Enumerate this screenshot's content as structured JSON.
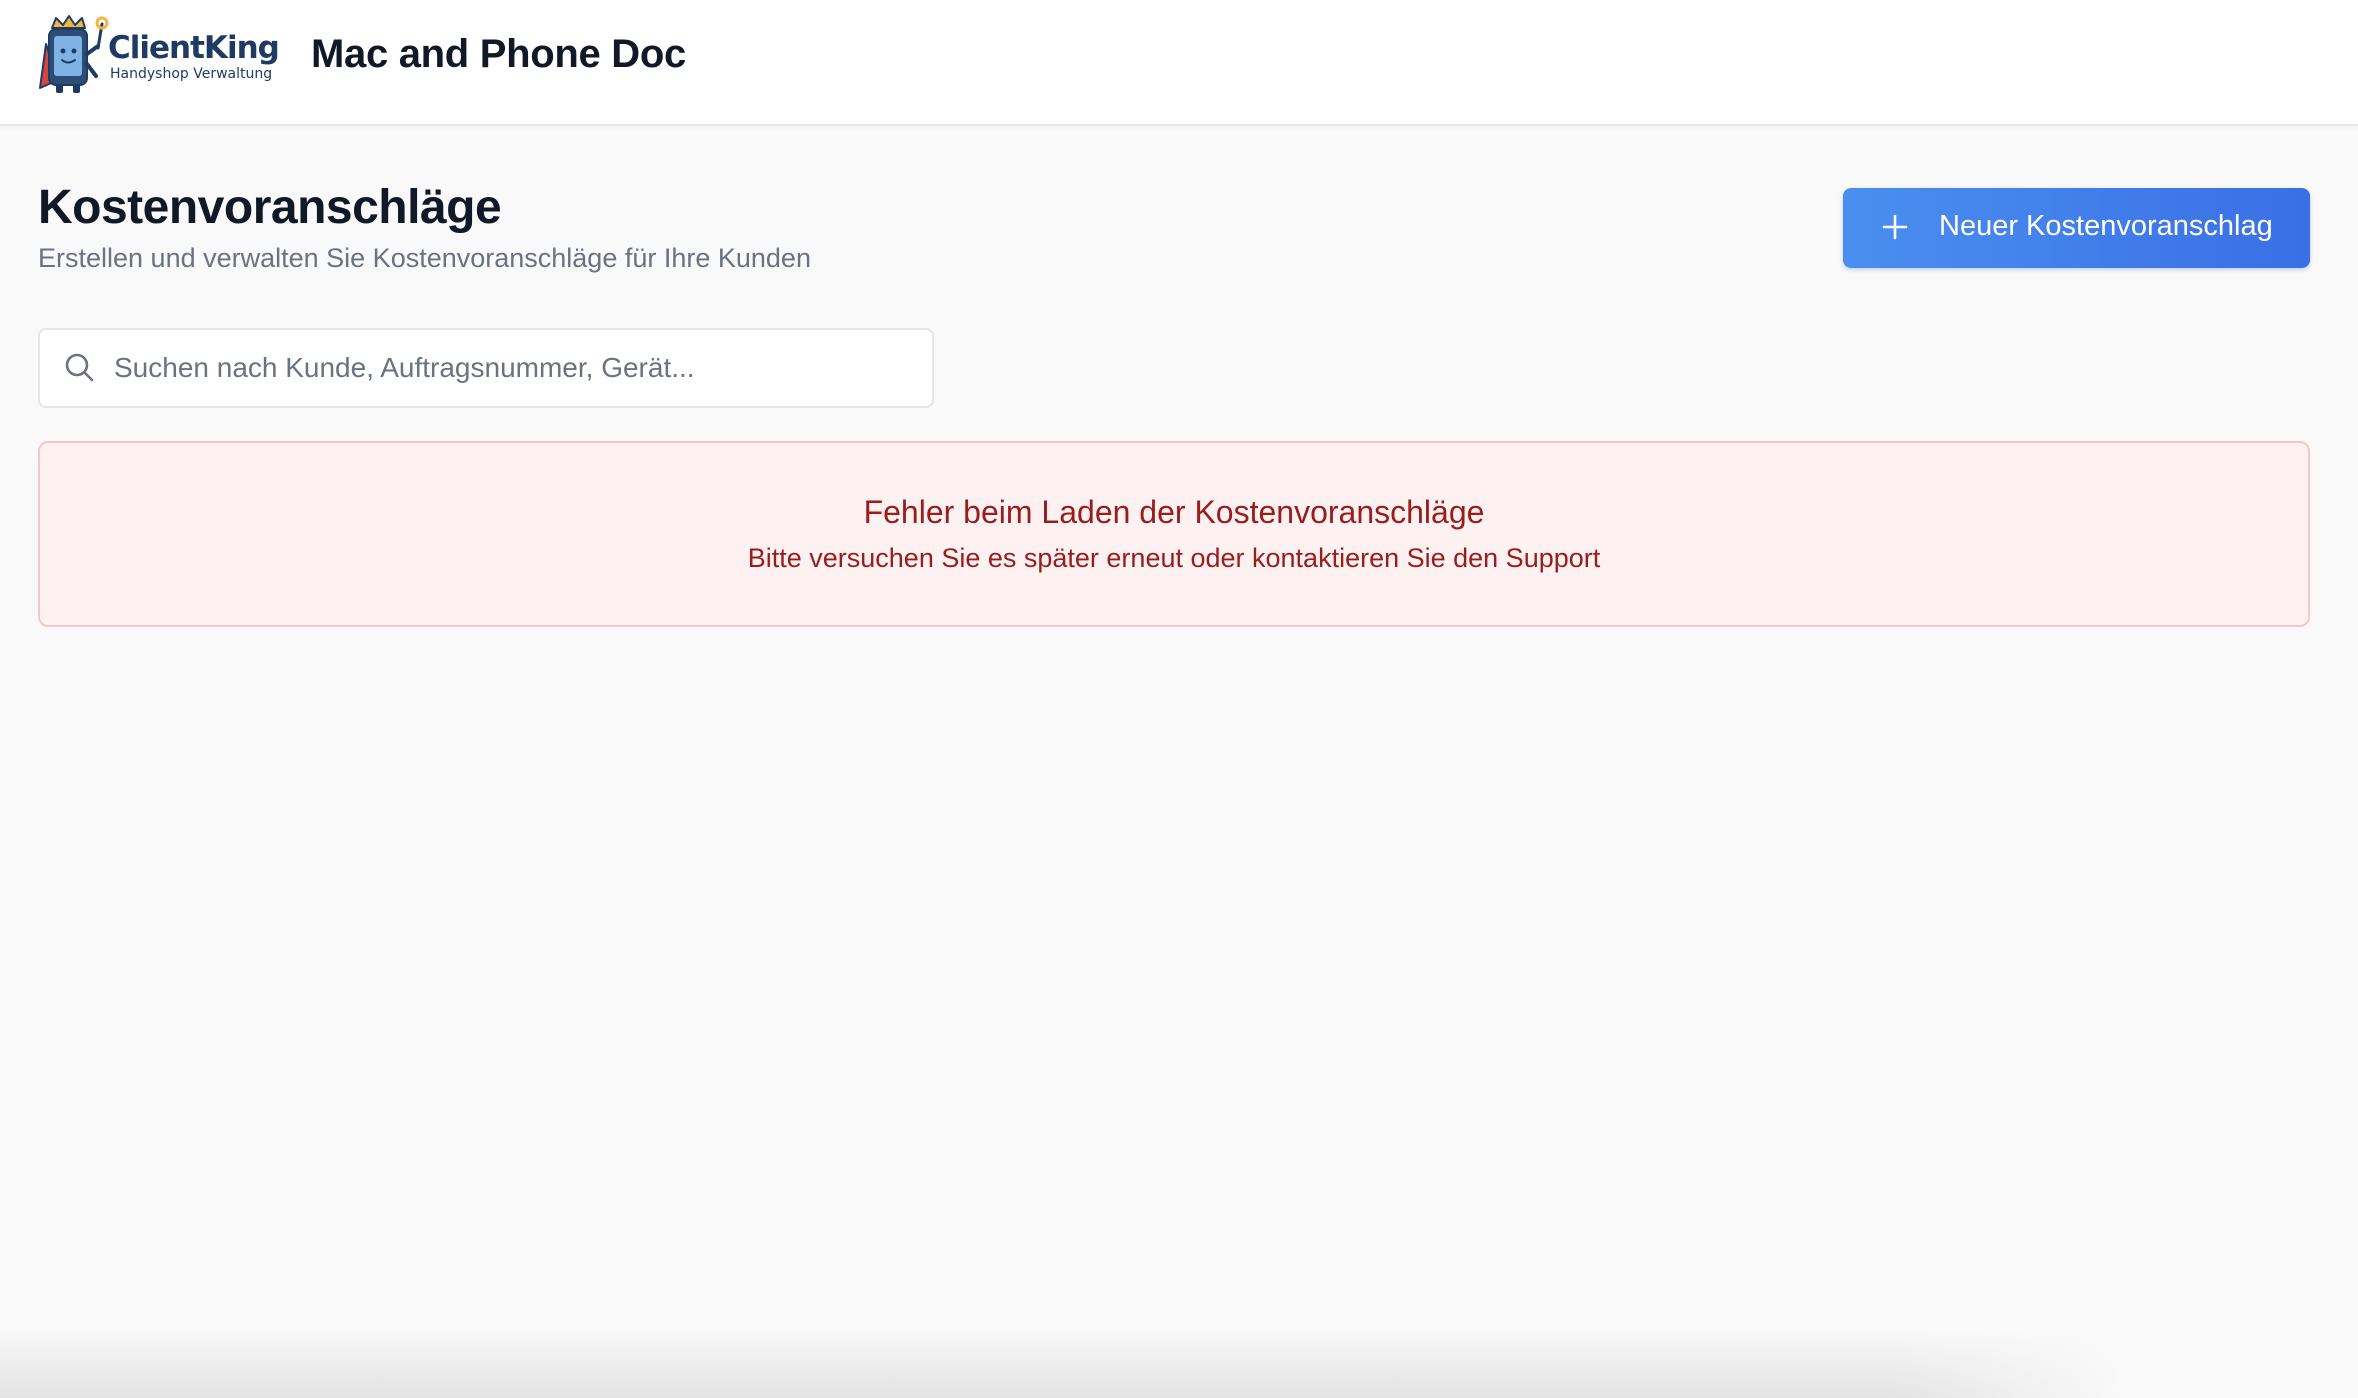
{
  "header": {
    "logo": {
      "name": "ClientKing",
      "tagline": "Handyshop Verwaltung"
    },
    "shop_name": "Mac and Phone Doc"
  },
  "main": {
    "title": "Kostenvoranschläge",
    "subtitle": "Erstellen und verwalten Sie Kostenvoranschläge für Ihre Kunden",
    "new_button": {
      "label": "Neuer Kostenvoranschlag",
      "icon": "plus-icon"
    },
    "search": {
      "placeholder": "Suchen nach Kunde, Auftragsnummer, Gerät...",
      "value": "",
      "icon": "search-icon"
    },
    "error": {
      "title": "Fehler beim Laden der Kostenvoranschläge",
      "message": "Bitte versuchen Sie es später erneut oder kontaktieren Sie den Support"
    }
  },
  "colors": {
    "accent": "#3b7ce9",
    "error_text": "#9b1c1c",
    "error_bg": "#fdf1f1",
    "error_border": "#f7c7c7",
    "brand": "#1f3b63"
  }
}
